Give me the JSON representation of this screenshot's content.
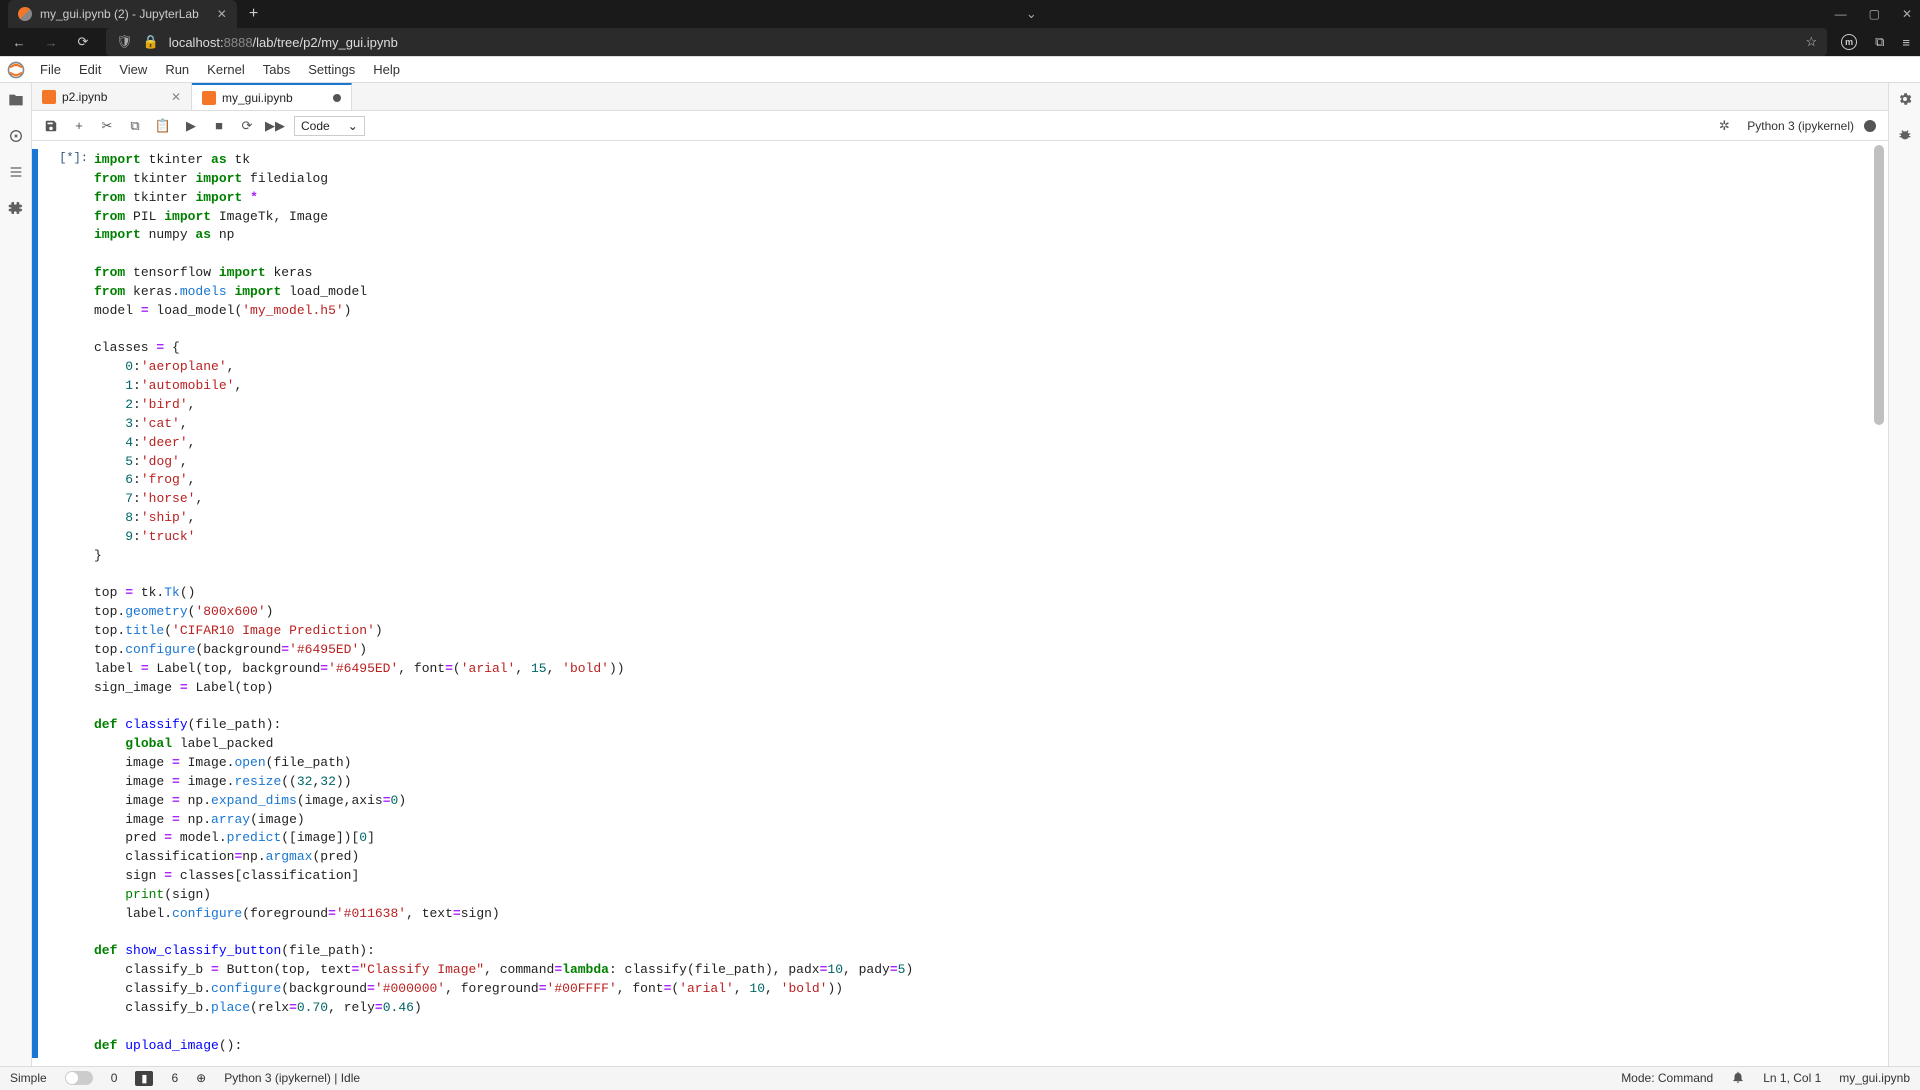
{
  "browser": {
    "tab_title": "my_gui.ipynb (2) - JupyterLab",
    "url_host": "localhost:",
    "url_port": "8888",
    "url_path": "/lab/tree/p2/my_gui.ipynb"
  },
  "menus": [
    "File",
    "Edit",
    "View",
    "Run",
    "Kernel",
    "Tabs",
    "Settings",
    "Help"
  ],
  "doc_tabs": [
    {
      "label": "p2.ipynb",
      "active": false,
      "dirty": false
    },
    {
      "label": "my_gui.ipynb",
      "active": true,
      "dirty": true
    }
  ],
  "toolbar": {
    "cell_type": "Code",
    "kernel_name": "Python 3 (ipykernel)"
  },
  "cell_prompt": "[*]:",
  "statusbar": {
    "simple": "Simple",
    "terms": "0",
    "warns": "6",
    "kernel": "Python 3 (ipykernel) | Idle",
    "mode": "Mode: Command",
    "pos": "Ln 1, Col 1",
    "file": "my_gui.ipynb"
  },
  "chart_data": null,
  "code_lines": [
    [
      {
        "t": "import",
        "c": "kw"
      },
      {
        "t": " tkinter ",
        "c": "nm"
      },
      {
        "t": "as",
        "c": "kw"
      },
      {
        "t": " tk",
        "c": "nm"
      }
    ],
    [
      {
        "t": "from",
        "c": "kw"
      },
      {
        "t": " tkinter ",
        "c": "nm"
      },
      {
        "t": "import",
        "c": "kw"
      },
      {
        "t": " filedialog",
        "c": "nm"
      }
    ],
    [
      {
        "t": "from",
        "c": "kw"
      },
      {
        "t": " tkinter ",
        "c": "nm"
      },
      {
        "t": "import",
        "c": "kw"
      },
      {
        "t": " ",
        "c": "nm"
      },
      {
        "t": "*",
        "c": "op"
      }
    ],
    [
      {
        "t": "from",
        "c": "kw"
      },
      {
        "t": " PIL ",
        "c": "nm"
      },
      {
        "t": "import",
        "c": "kw"
      },
      {
        "t": " ImageTk, Image",
        "c": "nm"
      }
    ],
    [
      {
        "t": "import",
        "c": "kw"
      },
      {
        "t": " numpy ",
        "c": "nm"
      },
      {
        "t": "as",
        "c": "kw"
      },
      {
        "t": " np",
        "c": "nm"
      }
    ],
    [
      {
        "t": "",
        "c": "nm"
      }
    ],
    [
      {
        "t": "from",
        "c": "kw"
      },
      {
        "t": " tensorflow ",
        "c": "nm"
      },
      {
        "t": "import",
        "c": "kw"
      },
      {
        "t": " keras",
        "c": "nm"
      }
    ],
    [
      {
        "t": "from",
        "c": "kw"
      },
      {
        "t": " keras.",
        "c": "nm"
      },
      {
        "t": "models",
        "c": "bl"
      },
      {
        "t": " ",
        "c": "nm"
      },
      {
        "t": "import",
        "c": "kw"
      },
      {
        "t": " load_model",
        "c": "nm"
      }
    ],
    [
      {
        "t": "model ",
        "c": "nm"
      },
      {
        "t": "=",
        "c": "op"
      },
      {
        "t": " load_model(",
        "c": "nm"
      },
      {
        "t": "'my_model.h5'",
        "c": "str"
      },
      {
        "t": ")",
        "c": "nm"
      }
    ],
    [
      {
        "t": "",
        "c": "nm"
      }
    ],
    [
      {
        "t": "classes ",
        "c": "nm"
      },
      {
        "t": "=",
        "c": "op"
      },
      {
        "t": " {",
        "c": "nm"
      }
    ],
    [
      {
        "t": "    ",
        "c": "nm"
      },
      {
        "t": "0",
        "c": "num"
      },
      {
        "t": ":",
        "c": "nm"
      },
      {
        "t": "'aeroplane'",
        "c": "str"
      },
      {
        "t": ",",
        "c": "nm"
      }
    ],
    [
      {
        "t": "    ",
        "c": "nm"
      },
      {
        "t": "1",
        "c": "num"
      },
      {
        "t": ":",
        "c": "nm"
      },
      {
        "t": "'automobile'",
        "c": "str"
      },
      {
        "t": ",",
        "c": "nm"
      }
    ],
    [
      {
        "t": "    ",
        "c": "nm"
      },
      {
        "t": "2",
        "c": "num"
      },
      {
        "t": ":",
        "c": "nm"
      },
      {
        "t": "'bird'",
        "c": "str"
      },
      {
        "t": ",",
        "c": "nm"
      }
    ],
    [
      {
        "t": "    ",
        "c": "nm"
      },
      {
        "t": "3",
        "c": "num"
      },
      {
        "t": ":",
        "c": "nm"
      },
      {
        "t": "'cat'",
        "c": "str"
      },
      {
        "t": ",",
        "c": "nm"
      }
    ],
    [
      {
        "t": "    ",
        "c": "nm"
      },
      {
        "t": "4",
        "c": "num"
      },
      {
        "t": ":",
        "c": "nm"
      },
      {
        "t": "'deer'",
        "c": "str"
      },
      {
        "t": ",",
        "c": "nm"
      }
    ],
    [
      {
        "t": "    ",
        "c": "nm"
      },
      {
        "t": "5",
        "c": "num"
      },
      {
        "t": ":",
        "c": "nm"
      },
      {
        "t": "'dog'",
        "c": "str"
      },
      {
        "t": ",",
        "c": "nm"
      }
    ],
    [
      {
        "t": "    ",
        "c": "nm"
      },
      {
        "t": "6",
        "c": "num"
      },
      {
        "t": ":",
        "c": "nm"
      },
      {
        "t": "'frog'",
        "c": "str"
      },
      {
        "t": ",",
        "c": "nm"
      }
    ],
    [
      {
        "t": "    ",
        "c": "nm"
      },
      {
        "t": "7",
        "c": "num"
      },
      {
        "t": ":",
        "c": "nm"
      },
      {
        "t": "'horse'",
        "c": "str"
      },
      {
        "t": ",",
        "c": "nm"
      }
    ],
    [
      {
        "t": "    ",
        "c": "nm"
      },
      {
        "t": "8",
        "c": "num"
      },
      {
        "t": ":",
        "c": "nm"
      },
      {
        "t": "'ship'",
        "c": "str"
      },
      {
        "t": ",",
        "c": "nm"
      }
    ],
    [
      {
        "t": "    ",
        "c": "nm"
      },
      {
        "t": "9",
        "c": "num"
      },
      {
        "t": ":",
        "c": "nm"
      },
      {
        "t": "'truck'",
        "c": "str"
      }
    ],
    [
      {
        "t": "}",
        "c": "nm"
      }
    ],
    [
      {
        "t": "",
        "c": "nm"
      }
    ],
    [
      {
        "t": "top ",
        "c": "nm"
      },
      {
        "t": "=",
        "c": "op"
      },
      {
        "t": " tk.",
        "c": "nm"
      },
      {
        "t": "Tk",
        "c": "bl"
      },
      {
        "t": "()",
        "c": "nm"
      }
    ],
    [
      {
        "t": "top.",
        "c": "nm"
      },
      {
        "t": "geometry",
        "c": "bl"
      },
      {
        "t": "(",
        "c": "nm"
      },
      {
        "t": "'800x600'",
        "c": "str"
      },
      {
        "t": ")",
        "c": "nm"
      }
    ],
    [
      {
        "t": "top.",
        "c": "nm"
      },
      {
        "t": "title",
        "c": "bl"
      },
      {
        "t": "(",
        "c": "nm"
      },
      {
        "t": "'CIFAR10 Image Prediction'",
        "c": "str"
      },
      {
        "t": ")",
        "c": "nm"
      }
    ],
    [
      {
        "t": "top.",
        "c": "nm"
      },
      {
        "t": "configure",
        "c": "bl"
      },
      {
        "t": "(background",
        "c": "nm"
      },
      {
        "t": "=",
        "c": "op"
      },
      {
        "t": "'#6495ED'",
        "c": "str"
      },
      {
        "t": ")",
        "c": "nm"
      }
    ],
    [
      {
        "t": "label ",
        "c": "nm"
      },
      {
        "t": "=",
        "c": "op"
      },
      {
        "t": " Label(top, background",
        "c": "nm"
      },
      {
        "t": "=",
        "c": "op"
      },
      {
        "t": "'#6495ED'",
        "c": "str"
      },
      {
        "t": ", font",
        "c": "nm"
      },
      {
        "t": "=",
        "c": "op"
      },
      {
        "t": "(",
        "c": "nm"
      },
      {
        "t": "'arial'",
        "c": "str"
      },
      {
        "t": ", ",
        "c": "nm"
      },
      {
        "t": "15",
        "c": "num"
      },
      {
        "t": ", ",
        "c": "nm"
      },
      {
        "t": "'bold'",
        "c": "str"
      },
      {
        "t": "))",
        "c": "nm"
      }
    ],
    [
      {
        "t": "sign_image ",
        "c": "nm"
      },
      {
        "t": "=",
        "c": "op"
      },
      {
        "t": " Label(top)",
        "c": "nm"
      }
    ],
    [
      {
        "t": "",
        "c": "nm"
      }
    ],
    [
      {
        "t": "def",
        "c": "kw"
      },
      {
        "t": " ",
        "c": "nm"
      },
      {
        "t": "classify",
        "c": "fn"
      },
      {
        "t": "(file_path):",
        "c": "nm"
      }
    ],
    [
      {
        "t": "    ",
        "c": "nm"
      },
      {
        "t": "global",
        "c": "kw"
      },
      {
        "t": " label_packed",
        "c": "nm"
      }
    ],
    [
      {
        "t": "    image ",
        "c": "nm"
      },
      {
        "t": "=",
        "c": "op"
      },
      {
        "t": " Image.",
        "c": "nm"
      },
      {
        "t": "open",
        "c": "bl"
      },
      {
        "t": "(file_path)",
        "c": "nm"
      }
    ],
    [
      {
        "t": "    image ",
        "c": "nm"
      },
      {
        "t": "=",
        "c": "op"
      },
      {
        "t": " image.",
        "c": "nm"
      },
      {
        "t": "resize",
        "c": "bl"
      },
      {
        "t": "((",
        "c": "nm"
      },
      {
        "t": "32",
        "c": "num"
      },
      {
        "t": ",",
        "c": "nm"
      },
      {
        "t": "32",
        "c": "num"
      },
      {
        "t": "))",
        "c": "nm"
      }
    ],
    [
      {
        "t": "    image ",
        "c": "nm"
      },
      {
        "t": "=",
        "c": "op"
      },
      {
        "t": " np.",
        "c": "nm"
      },
      {
        "t": "expand_dims",
        "c": "bl"
      },
      {
        "t": "(image,axis",
        "c": "nm"
      },
      {
        "t": "=",
        "c": "op"
      },
      {
        "t": "0",
        "c": "num"
      },
      {
        "t": ")",
        "c": "nm"
      }
    ],
    [
      {
        "t": "    image ",
        "c": "nm"
      },
      {
        "t": "=",
        "c": "op"
      },
      {
        "t": " np.",
        "c": "nm"
      },
      {
        "t": "array",
        "c": "bl"
      },
      {
        "t": "(image)",
        "c": "nm"
      }
    ],
    [
      {
        "t": "    pred ",
        "c": "nm"
      },
      {
        "t": "=",
        "c": "op"
      },
      {
        "t": " model.",
        "c": "nm"
      },
      {
        "t": "predict",
        "c": "bl"
      },
      {
        "t": "([image])[",
        "c": "nm"
      },
      {
        "t": "0",
        "c": "num"
      },
      {
        "t": "]",
        "c": "nm"
      }
    ],
    [
      {
        "t": "    classification",
        "c": "nm"
      },
      {
        "t": "=",
        "c": "op"
      },
      {
        "t": "np.",
        "c": "nm"
      },
      {
        "t": "argmax",
        "c": "bl"
      },
      {
        "t": "(pred)",
        "c": "nm"
      }
    ],
    [
      {
        "t": "    sign ",
        "c": "nm"
      },
      {
        "t": "=",
        "c": "op"
      },
      {
        "t": " classes[classification]",
        "c": "nm"
      }
    ],
    [
      {
        "t": "    ",
        "c": "nm"
      },
      {
        "t": "print",
        "c": "bi"
      },
      {
        "t": "(sign)",
        "c": "nm"
      }
    ],
    [
      {
        "t": "    label.",
        "c": "nm"
      },
      {
        "t": "configure",
        "c": "bl"
      },
      {
        "t": "(foreground",
        "c": "nm"
      },
      {
        "t": "=",
        "c": "op"
      },
      {
        "t": "'#011638'",
        "c": "str"
      },
      {
        "t": ", text",
        "c": "nm"
      },
      {
        "t": "=",
        "c": "op"
      },
      {
        "t": "sign)",
        "c": "nm"
      }
    ],
    [
      {
        "t": "",
        "c": "nm"
      }
    ],
    [
      {
        "t": "def",
        "c": "kw"
      },
      {
        "t": " ",
        "c": "nm"
      },
      {
        "t": "show_classify_button",
        "c": "fn"
      },
      {
        "t": "(file_path):",
        "c": "nm"
      }
    ],
    [
      {
        "t": "    classify_b ",
        "c": "nm"
      },
      {
        "t": "=",
        "c": "op"
      },
      {
        "t": " Button(top, text",
        "c": "nm"
      },
      {
        "t": "=",
        "c": "op"
      },
      {
        "t": "\"Classify Image\"",
        "c": "str"
      },
      {
        "t": ", command",
        "c": "nm"
      },
      {
        "t": "=",
        "c": "op"
      },
      {
        "t": "lambda",
        "c": "kw"
      },
      {
        "t": ": classify(file_path), padx",
        "c": "nm"
      },
      {
        "t": "=",
        "c": "op"
      },
      {
        "t": "10",
        "c": "num"
      },
      {
        "t": ", pady",
        "c": "nm"
      },
      {
        "t": "=",
        "c": "op"
      },
      {
        "t": "5",
        "c": "num"
      },
      {
        "t": ")",
        "c": "nm"
      }
    ],
    [
      {
        "t": "    classify_b.",
        "c": "nm"
      },
      {
        "t": "configure",
        "c": "bl"
      },
      {
        "t": "(background",
        "c": "nm"
      },
      {
        "t": "=",
        "c": "op"
      },
      {
        "t": "'#000000'",
        "c": "str"
      },
      {
        "t": ", foreground",
        "c": "nm"
      },
      {
        "t": "=",
        "c": "op"
      },
      {
        "t": "'#00FFFF'",
        "c": "str"
      },
      {
        "t": ", font",
        "c": "nm"
      },
      {
        "t": "=",
        "c": "op"
      },
      {
        "t": "(",
        "c": "nm"
      },
      {
        "t": "'arial'",
        "c": "str"
      },
      {
        "t": ", ",
        "c": "nm"
      },
      {
        "t": "10",
        "c": "num"
      },
      {
        "t": ", ",
        "c": "nm"
      },
      {
        "t": "'bold'",
        "c": "str"
      },
      {
        "t": "))",
        "c": "nm"
      }
    ],
    [
      {
        "t": "    classify_b.",
        "c": "nm"
      },
      {
        "t": "place",
        "c": "bl"
      },
      {
        "t": "(relx",
        "c": "nm"
      },
      {
        "t": "=",
        "c": "op"
      },
      {
        "t": "0.70",
        "c": "num"
      },
      {
        "t": ", rely",
        "c": "nm"
      },
      {
        "t": "=",
        "c": "op"
      },
      {
        "t": "0.46",
        "c": "num"
      },
      {
        "t": ")",
        "c": "nm"
      }
    ],
    [
      {
        "t": "",
        "c": "nm"
      }
    ],
    [
      {
        "t": "def",
        "c": "kw"
      },
      {
        "t": " ",
        "c": "nm"
      },
      {
        "t": "upload_image",
        "c": "fn"
      },
      {
        "t": "():",
        "c": "nm"
      }
    ]
  ]
}
